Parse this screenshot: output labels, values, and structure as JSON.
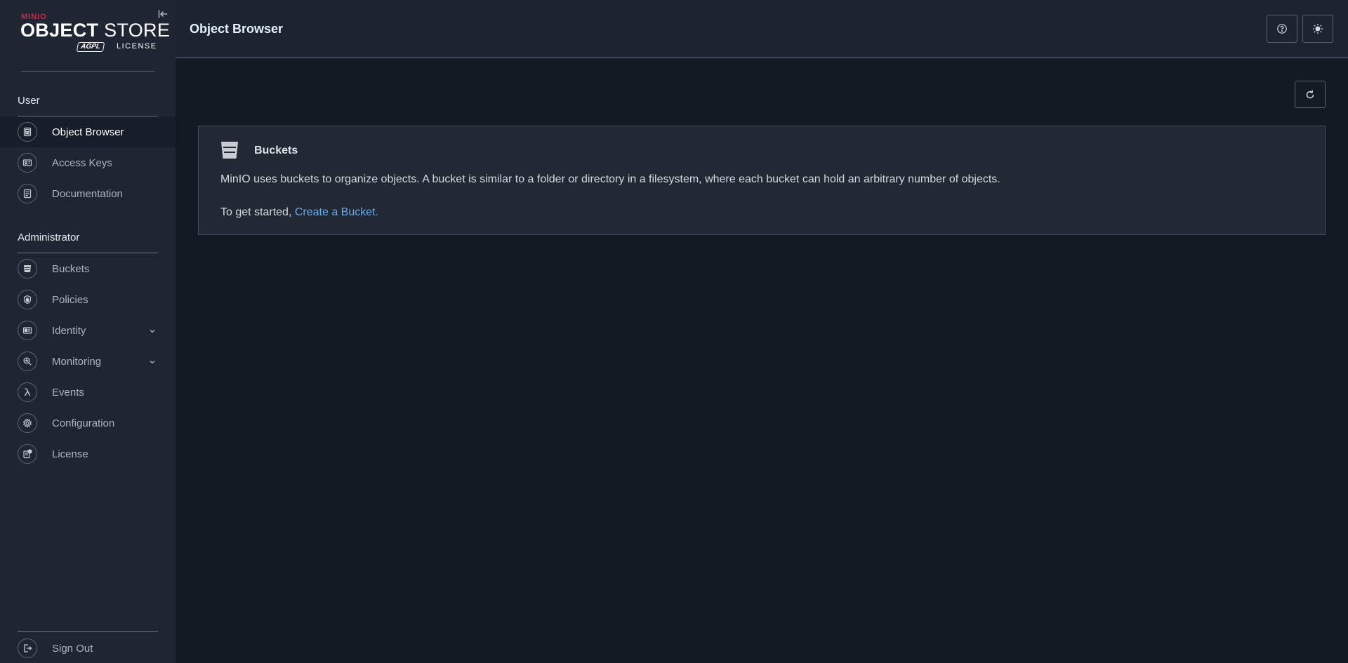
{
  "brand": {
    "name": "MINIO",
    "product_bold": "OBJECT",
    "product_rest": " STORE",
    "license_badge": "AGPL",
    "license_label": "LICENSE"
  },
  "sidebar": {
    "user_section": "User",
    "user_items": [
      {
        "label": "Object Browser",
        "icon": "object-browser-icon",
        "active": true
      },
      {
        "label": "Access Keys",
        "icon": "access-keys-icon"
      },
      {
        "label": "Documentation",
        "icon": "documentation-icon"
      }
    ],
    "admin_section": "Administrator",
    "admin_items": [
      {
        "label": "Buckets",
        "icon": "bucket-icon"
      },
      {
        "label": "Policies",
        "icon": "lock-icon"
      },
      {
        "label": "Identity",
        "icon": "identity-card-icon",
        "expandable": true
      },
      {
        "label": "Monitoring",
        "icon": "magnifier-icon",
        "expandable": true
      },
      {
        "label": "Events",
        "icon": "lambda-icon"
      },
      {
        "label": "Configuration",
        "icon": "gear-icon"
      },
      {
        "label": "License",
        "icon": "license-icon"
      }
    ],
    "sign_out": "Sign Out"
  },
  "header": {
    "title": "Object Browser",
    "help_icon": "help-icon",
    "theme_icon": "sun-icon"
  },
  "main": {
    "refresh_icon": "refresh-icon",
    "card": {
      "title": "Buckets",
      "description": "MinIO uses buckets to organize objects. A bucket is similar to a folder or directory in a filesystem, where each bucket can hold an arbitrary number of objects.",
      "cta_prefix": "To get started, ",
      "cta_link": "Create a Bucket."
    }
  },
  "colors": {
    "sidebar_bg": "#1f2533",
    "main_bg": "#131a23",
    "brand_red": "#c72c48",
    "link_blue": "#6ca9e8"
  }
}
